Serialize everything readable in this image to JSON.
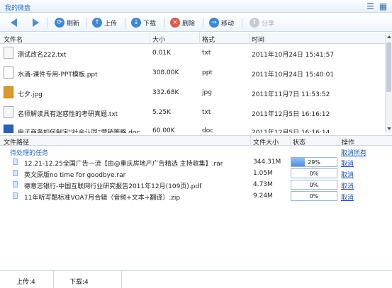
{
  "window": {
    "title": "我的微盘"
  },
  "toolbar": {
    "refresh": "刷新",
    "upload": "上传",
    "download": "下载",
    "delete": "删除",
    "move": "移动",
    "share": "分享"
  },
  "file_columns": [
    "文件名",
    "大小",
    "格式",
    "时间"
  ],
  "files": [
    {
      "name": "测试改名222.txt",
      "size": "0.01K",
      "format": "txt",
      "time": "2011年10月24日 15:41:57",
      "icon": "txt-file-icon"
    },
    {
      "name": "水滴-课件专用-PPT模板.ppt",
      "size": "308.00K",
      "format": "ppt",
      "time": "2011年10月24日 15:40:01",
      "icon": "ppt-file-icon"
    },
    {
      "name": "七夕.jpg",
      "size": "332.68K",
      "format": "jpg",
      "time": "2011年11月7日 11:53:52",
      "icon": "jpg-file-icon"
    },
    {
      "name": "名师解读具有迷惑性的考研真题.txt",
      "size": "5.25K",
      "format": "txt",
      "time": "2011年12月5日 16:16:12",
      "icon": "txt-file-icon"
    },
    {
      "name": "电子商务如何制定“社会认同”营销策略.doc",
      "size": "60.00K",
      "format": "doc",
      "time": "2011年12月5日 16:16:14",
      "icon": "doc-file-icon"
    }
  ],
  "task_columns": [
    "文件路径",
    "文件大小",
    "状态",
    "操作"
  ],
  "tasks": {
    "group_label": "待处理的任务",
    "cancel_all": "取消所有",
    "items": [
      {
        "path": "12.21-12.25全国广告一流【由@重庆房地产广告精选 主持收集】.rar",
        "size": "344.31M",
        "progress": 29,
        "progress_label": "29%",
        "action": "取消"
      },
      {
        "path": "英文原版no time for goodbye.rar",
        "size": "1.05M",
        "progress": 0,
        "progress_label": "0%",
        "action": "取消"
      },
      {
        "path": "德意志银行-中国互联网行业研究报告2011年12月(109页).pdf",
        "size": "4.73M",
        "progress": 0,
        "progress_label": "0%",
        "action": "取消"
      },
      {
        "path": "11年听写酷标准VOA7月合辑（音频+文本+翻译）.zip",
        "size": "9.24M",
        "progress": 0,
        "progress_label": "0%",
        "action": "取消"
      }
    ]
  },
  "status": {
    "upload": "上传:4",
    "download": "下载:4"
  }
}
